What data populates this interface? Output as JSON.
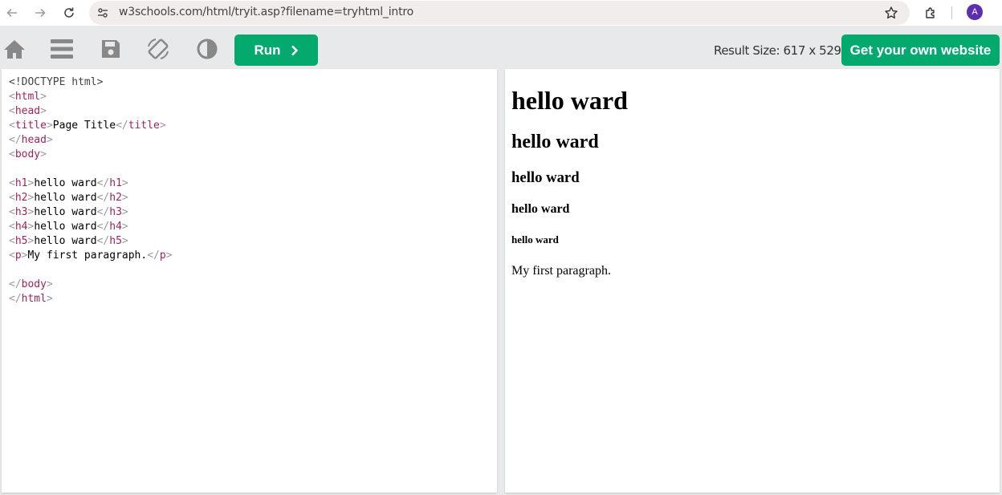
{
  "browser": {
    "url": "w3schools.com/html/tryit.asp?filename=tryhtml_intro",
    "avatar_letter": "A",
    "icons": [
      "back-arrow-icon",
      "forward-arrow-icon",
      "reload-icon",
      "site-settings-icon",
      "bookmark-star-icon",
      "extensions-icon"
    ]
  },
  "toolbar": {
    "run_label": "Run",
    "run_icon": "chevron-right-icon",
    "result_size": "Result Size: 617 x 529",
    "get_website_label": "Get your own website",
    "icons": [
      "home-icon",
      "menu-icon",
      "save-icon",
      "rotate-icon",
      "contrast-icon"
    ],
    "accent_color": "#04aa6d"
  },
  "editor": {
    "lines": [
      [
        {
          "t": "<!DOCTYPE html>",
          "c": "doc"
        }
      ],
      [
        {
          "t": "<",
          "c": "br"
        },
        {
          "t": "html",
          "c": "tg"
        },
        {
          "t": ">",
          "c": "br"
        }
      ],
      [
        {
          "t": "<",
          "c": "br"
        },
        {
          "t": "head",
          "c": "tg"
        },
        {
          "t": ">",
          "c": "br"
        }
      ],
      [
        {
          "t": "<",
          "c": "br"
        },
        {
          "t": "title",
          "c": "tg"
        },
        {
          "t": ">",
          "c": "br"
        },
        {
          "t": "Page Title",
          "c": "tx"
        },
        {
          "t": "</",
          "c": "br"
        },
        {
          "t": "title",
          "c": "tg"
        },
        {
          "t": ">",
          "c": "br"
        }
      ],
      [
        {
          "t": "</",
          "c": "br"
        },
        {
          "t": "head",
          "c": "tg"
        },
        {
          "t": ">",
          "c": "br"
        }
      ],
      [
        {
          "t": "<",
          "c": "br"
        },
        {
          "t": "body",
          "c": "tg"
        },
        {
          "t": ">",
          "c": "br"
        }
      ],
      [],
      [
        {
          "t": "<",
          "c": "br"
        },
        {
          "t": "h1",
          "c": "tg"
        },
        {
          "t": ">",
          "c": "br"
        },
        {
          "t": "hello ward",
          "c": "tx"
        },
        {
          "t": "</",
          "c": "br"
        },
        {
          "t": "h1",
          "c": "tg"
        },
        {
          "t": ">",
          "c": "br"
        }
      ],
      [
        {
          "t": "<",
          "c": "br"
        },
        {
          "t": "h2",
          "c": "tg"
        },
        {
          "t": ">",
          "c": "br"
        },
        {
          "t": "hello ward",
          "c": "tx"
        },
        {
          "t": "</",
          "c": "br"
        },
        {
          "t": "h2",
          "c": "tg"
        },
        {
          "t": ">",
          "c": "br"
        }
      ],
      [
        {
          "t": "<",
          "c": "br"
        },
        {
          "t": "h3",
          "c": "tg"
        },
        {
          "t": ">",
          "c": "br"
        },
        {
          "t": "hello ward",
          "c": "tx"
        },
        {
          "t": "</",
          "c": "br"
        },
        {
          "t": "h3",
          "c": "tg"
        },
        {
          "t": ">",
          "c": "br"
        }
      ],
      [
        {
          "t": "<",
          "c": "br"
        },
        {
          "t": "h4",
          "c": "tg"
        },
        {
          "t": ">",
          "c": "br"
        },
        {
          "t": "hello ward",
          "c": "tx"
        },
        {
          "t": "</",
          "c": "br"
        },
        {
          "t": "h4",
          "c": "tg"
        },
        {
          "t": ">",
          "c": "br"
        }
      ],
      [
        {
          "t": "<",
          "c": "br"
        },
        {
          "t": "h5",
          "c": "tg"
        },
        {
          "t": ">",
          "c": "br"
        },
        {
          "t": "hello ward",
          "c": "tx"
        },
        {
          "t": "</",
          "c": "br"
        },
        {
          "t": "h5",
          "c": "tg"
        },
        {
          "t": ">",
          "c": "br"
        }
      ],
      [
        {
          "t": "<",
          "c": "br"
        },
        {
          "t": "p",
          "c": "tg"
        },
        {
          "t": ">",
          "c": "br"
        },
        {
          "t": "My first paragraph.",
          "c": "tx"
        },
        {
          "t": "</",
          "c": "br"
        },
        {
          "t": "p",
          "c": "tg"
        },
        {
          "t": ">",
          "c": "br"
        }
      ],
      [],
      [
        {
          "t": "</",
          "c": "br"
        },
        {
          "t": "body",
          "c": "tg"
        },
        {
          "t": ">",
          "c": "br"
        }
      ],
      [
        {
          "t": "</",
          "c": "br"
        },
        {
          "t": "html",
          "c": "tg"
        },
        {
          "t": ">",
          "c": "br"
        }
      ]
    ]
  },
  "result": {
    "h1": "hello ward",
    "h2": "hello ward",
    "h3": "hello ward",
    "h4": "hello ward",
    "h5": "hello ward",
    "p": "My first paragraph."
  }
}
